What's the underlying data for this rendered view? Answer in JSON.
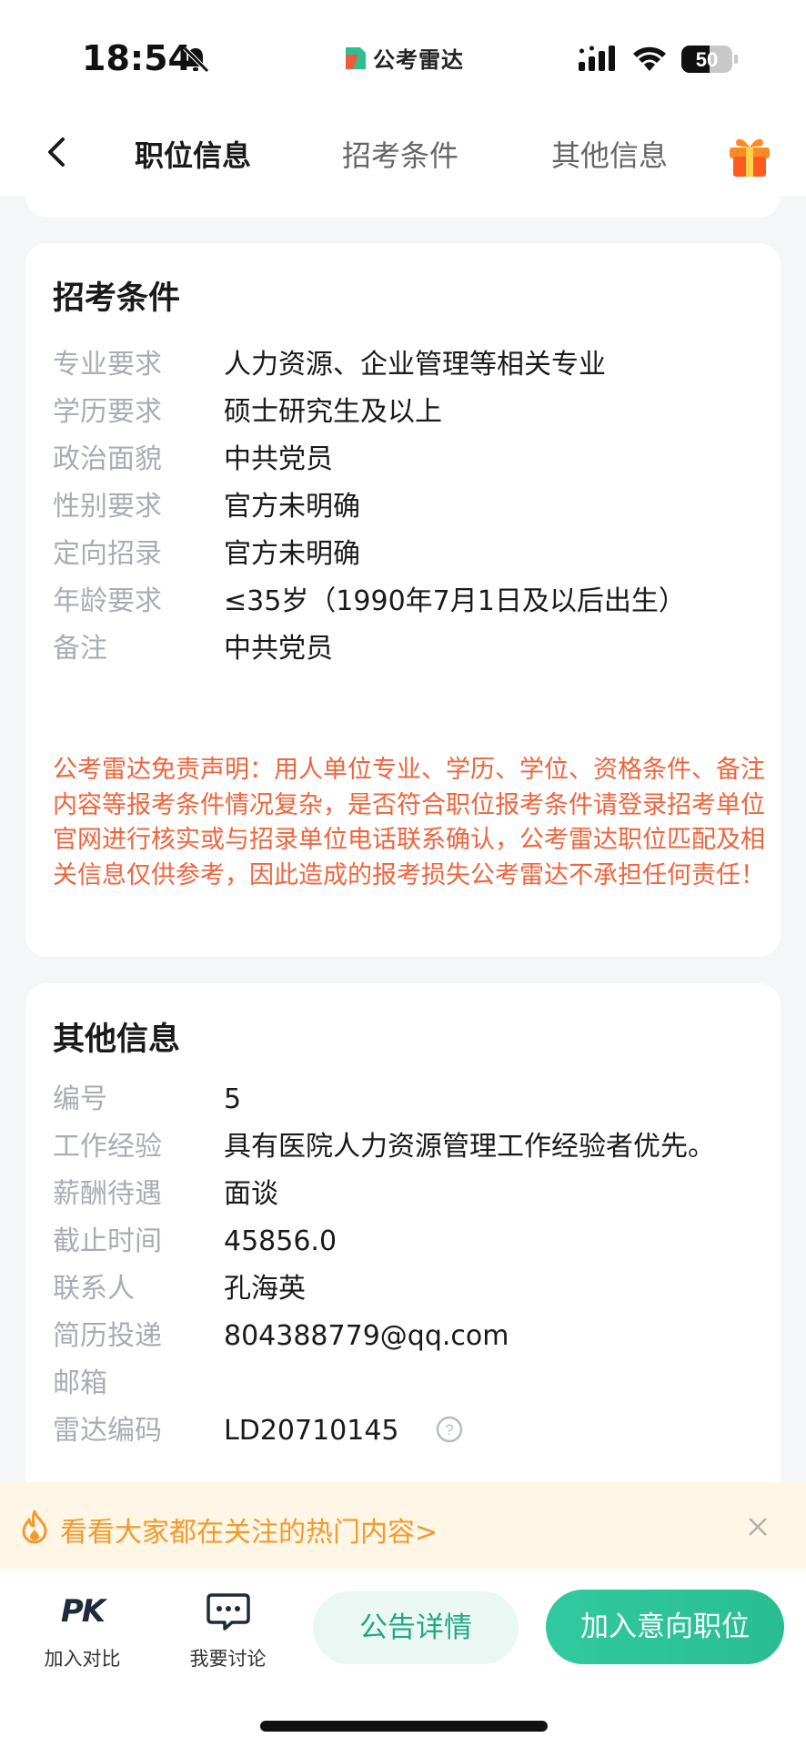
{
  "status_bar": {
    "time": "18:54",
    "logo_text": "公考雷达",
    "battery": "50"
  },
  "nav": {
    "tabs": [
      {
        "label": "职位信息",
        "active": true
      },
      {
        "label": "招考条件",
        "active": false
      },
      {
        "label": "其他信息",
        "active": false
      }
    ],
    "accent": "#22b893"
  },
  "conditions": {
    "title": "招考条件",
    "rows": [
      {
        "key": "专业要求",
        "value": "人力资源、企业管理等相关专业"
      },
      {
        "key": "学历要求",
        "value": "硕士研究生及以上"
      },
      {
        "key": "政治面貌",
        "value": "中共党员"
      },
      {
        "key": "性别要求",
        "value": "官方未明确"
      },
      {
        "key": "定向招录",
        "value": "官方未明确"
      },
      {
        "key": "年龄要求",
        "value": "≤35岁（1990年7月1日及以后出生）"
      },
      {
        "key": "备注",
        "value": "中共党员"
      }
    ],
    "disclaimer": "公考雷达免责声明：用人单位专业、学历、学位、资格条件、备注内容等报考条件情况复杂，是否符合职位报考条件请登录招考单位官网进行核实或与招录单位电话联系确认，公考雷达职位匹配及相关信息仅供参考，因此造成的报考损失公考雷达不承担任何责任！",
    "disclaimer_color": "#f0643c"
  },
  "other": {
    "title": "其他信息",
    "rows": [
      {
        "key": "编号",
        "value": "5"
      },
      {
        "key": "工作经验",
        "value": "具有医院人力资源管理工作经验者优先。"
      },
      {
        "key": "薪酬待遇",
        "value": "面谈"
      },
      {
        "key": "截止时间",
        "value": "45856.0"
      },
      {
        "key": "联系人",
        "value": "孔海英"
      },
      {
        "key": "简历投递邮箱",
        "value": "804388779@qq.com"
      },
      {
        "key": "雷达编码",
        "value": "LD20710145"
      }
    ]
  },
  "tip": {
    "text": "看看大家都在关注的热门内容>",
    "color": "#f29a2e"
  },
  "bottom_bar": {
    "pk_icon_text": "PK",
    "pk_label": "加入对比",
    "discuss_label": "我要讨论",
    "detail_button": "公告详情",
    "join_button": "加入意向职位"
  }
}
